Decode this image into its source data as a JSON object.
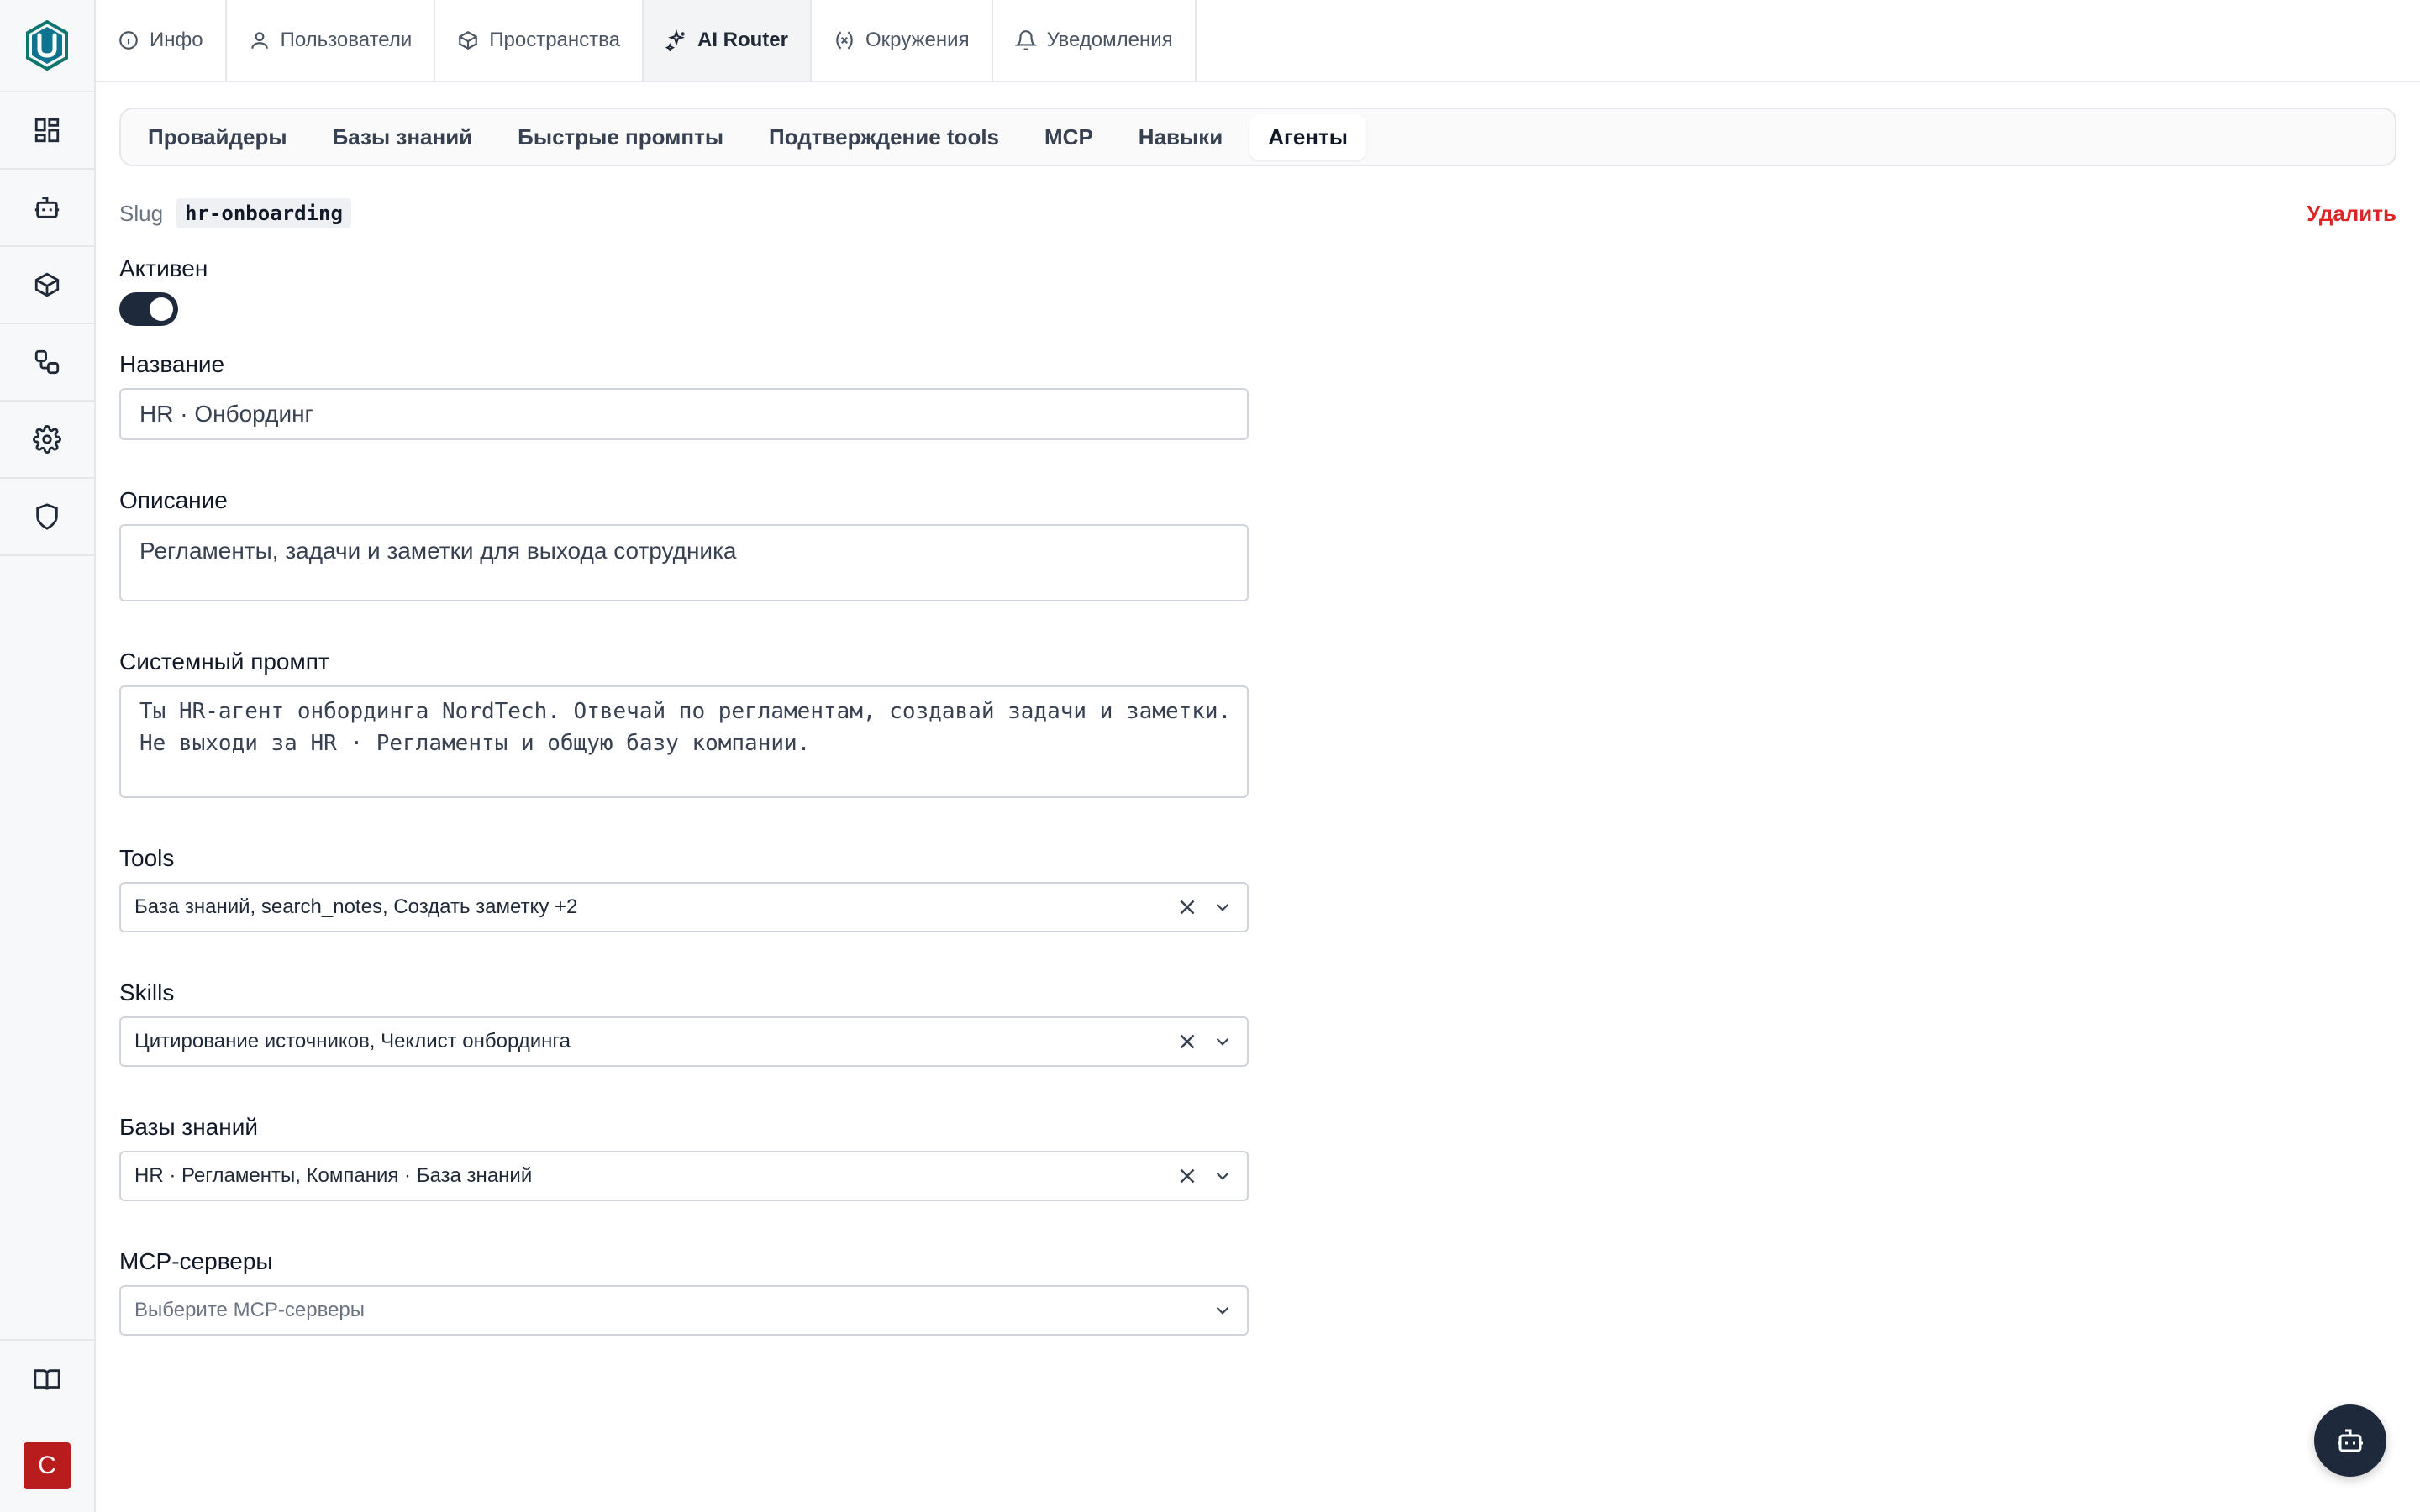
{
  "sidebar": {
    "logo_icon": "logo-u-icon",
    "items": [
      {
        "icon": "dashboard-icon"
      },
      {
        "icon": "bot-icon"
      },
      {
        "icon": "cube-icon"
      },
      {
        "icon": "workflow-icon"
      },
      {
        "icon": "gear-icon"
      },
      {
        "icon": "shield-icon"
      }
    ],
    "bottom": {
      "icon": "book-icon",
      "avatar_initial": "С"
    }
  },
  "topnav": {
    "tabs": [
      {
        "label": "Инфо",
        "icon": "info-icon"
      },
      {
        "label": "Пользователи",
        "icon": "user-icon"
      },
      {
        "label": "Пространства",
        "icon": "cube-icon"
      },
      {
        "label": "AI Router",
        "icon": "sparkles-icon",
        "active": true
      },
      {
        "label": "Окружения",
        "icon": "variable-icon"
      },
      {
        "label": "Уведомления",
        "icon": "bell-icon"
      }
    ]
  },
  "subnav": {
    "tabs": [
      {
        "label": "Провайдеры"
      },
      {
        "label": "Базы знаний"
      },
      {
        "label": "Быстрые промпты"
      },
      {
        "label": "Подтверждение tools"
      },
      {
        "label": "MCP"
      },
      {
        "label": "Навыки"
      },
      {
        "label": "Агенты",
        "active": true
      }
    ]
  },
  "agent": {
    "slug_label": "Slug",
    "slug_value": "hr-onboarding",
    "delete_label": "Удалить",
    "active_label": "Активен",
    "active": true,
    "name_label": "Название",
    "name_value": "HR · Онбординг",
    "description_label": "Описание",
    "description_value": "Регламенты, задачи и заметки для выхода сотрудника",
    "prompt_label": "Системный промпт",
    "prompt_value": "Ты HR-агент онбординга NordTech. Отвечай по регламентам, создавай задачи и заметки.\nНе выходи за HR · Регламенты и общую базу компании.",
    "tools_label": "Tools",
    "tools_value": "База знаний, search_notes, Создать заметку +2",
    "skills_label": "Skills",
    "skills_value": "Цитирование источников, Чеклист онбординга",
    "kb_label": "Базы знаний",
    "kb_value": "HR · Регламенты, Компания · База знаний",
    "mcp_label": "MCP-серверы",
    "mcp_placeholder": "Выберите MCP-серверы"
  },
  "colors": {
    "accent_dark": "#1e293b",
    "danger": "#dc2626",
    "logo": "#0f766e",
    "avatar": "#b91c1c"
  }
}
